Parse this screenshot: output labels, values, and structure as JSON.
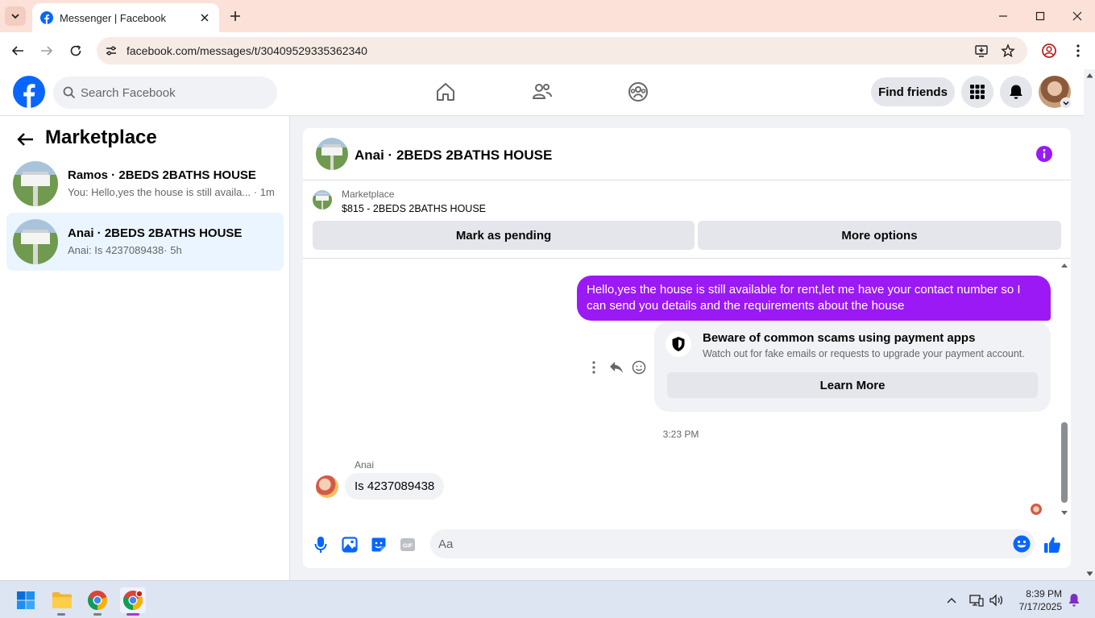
{
  "browser": {
    "tab_title": "Messenger | Facebook",
    "url": "facebook.com/messages/t/30409529335362340"
  },
  "fb_header": {
    "search_placeholder": "Search Facebook",
    "find_friends_label": "Find friends",
    "brand_color": "#0866ff"
  },
  "left_panel": {
    "title": "Marketplace",
    "conversations": [
      {
        "name": "Ramos · 2BEDS 2BATHS HOUSE",
        "preview": "You: Hello,yes the house is still availa...",
        "time": "· 1m",
        "active": false
      },
      {
        "name": "Anai · 2BEDS 2BATHS HOUSE",
        "preview": "Anai: Is 4237089438",
        "time": "· 5h",
        "active": true
      }
    ]
  },
  "chat": {
    "title": "Anai · 2BEDS 2BATHS HOUSE",
    "listing_label": "Marketplace",
    "listing_title": "$815 - 2BEDS 2BATHS HOUSE",
    "mark_pending_label": "Mark as pending",
    "more_options_label": "More options",
    "outgoing_message": "Hello,yes the house is still available for rent,let me have your contact number   so I can send you details and the requirements about the house",
    "scam_title": "Beware of common scams using payment apps",
    "scam_body": "Watch out for fake emails or requests to upgrade your payment account.",
    "learn_more_label": "Learn More",
    "time_separator": "3:23 PM",
    "incoming_sender": "Anai",
    "incoming_message": "Is 4237089438",
    "composer_placeholder": "Aa",
    "accent_color": "#9b19f5"
  },
  "taskbar": {
    "time": "8:39 PM",
    "date": "7/17/2025"
  }
}
